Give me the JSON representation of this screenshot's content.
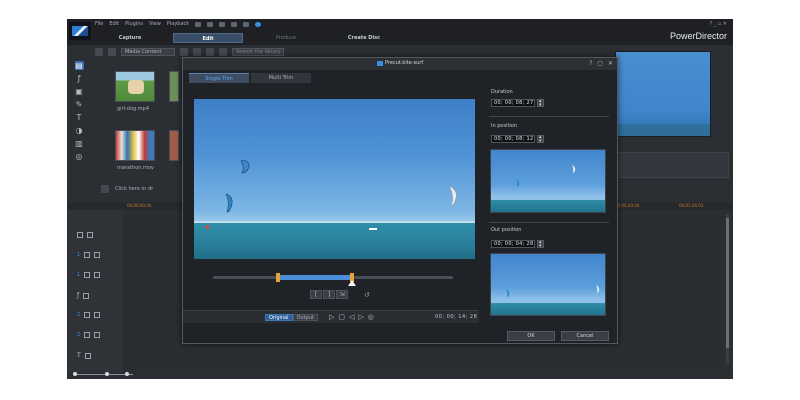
{
  "app": {
    "brand": "PowerDirector",
    "menu": [
      "File",
      "Edit",
      "Plugins",
      "View",
      "Playback"
    ],
    "mode_tabs": [
      {
        "label": "Capture"
      },
      {
        "label": "Edit"
      },
      {
        "label": "Produce"
      },
      {
        "label": "Create Disc"
      }
    ],
    "window_controls": "? _ ▫ ✕"
  },
  "library": {
    "filter_label": "Media Content",
    "search_placeholder": "Search the library",
    "items": [
      {
        "label": "girl-dog.mp4"
      },
      {
        "label": "marathon.mov"
      }
    ]
  },
  "timeline": {
    "hint": "Click here or dr",
    "ruler_marks": [
      "00;00;00;00",
      "00;00;43;04",
      "00;01;26;03"
    ],
    "tracks": [
      {
        "num": "1",
        "icon": "video-track-icon"
      },
      {
        "num": "1",
        "icon": "audio-track-icon"
      },
      {
        "num": "",
        "icon": "fx-track-icon"
      },
      {
        "num": "2",
        "icon": "video-track-icon"
      },
      {
        "num": "2",
        "icon": "audio-track-icon"
      },
      {
        "num": "",
        "icon": "title-track-icon"
      },
      {
        "num": "",
        "icon": "voice-track-icon"
      }
    ]
  },
  "dialog": {
    "title": "Precut.kite-surf",
    "tabs": [
      {
        "label": "Single Trim",
        "active": true
      },
      {
        "label": "Multi Trim",
        "active": false
      }
    ],
    "duration_label": "Duration",
    "duration_value": "00; 00; 08; 27",
    "in_label": "In position",
    "in_value": "00; 00; 08; 12",
    "out_label": "Out position",
    "out_value": "00; 00; 04; 28",
    "mode_original": "Original",
    "mode_output": "Output",
    "timecode": "00; 00; 14; 28",
    "ok_label": "OK",
    "cancel_label": "Cancel",
    "selection": {
      "start": 0.27,
      "end": 0.58
    }
  },
  "colors": {
    "accent": "#3a8ee6",
    "marker": "#e8a23a",
    "panel": "#1f2226"
  }
}
